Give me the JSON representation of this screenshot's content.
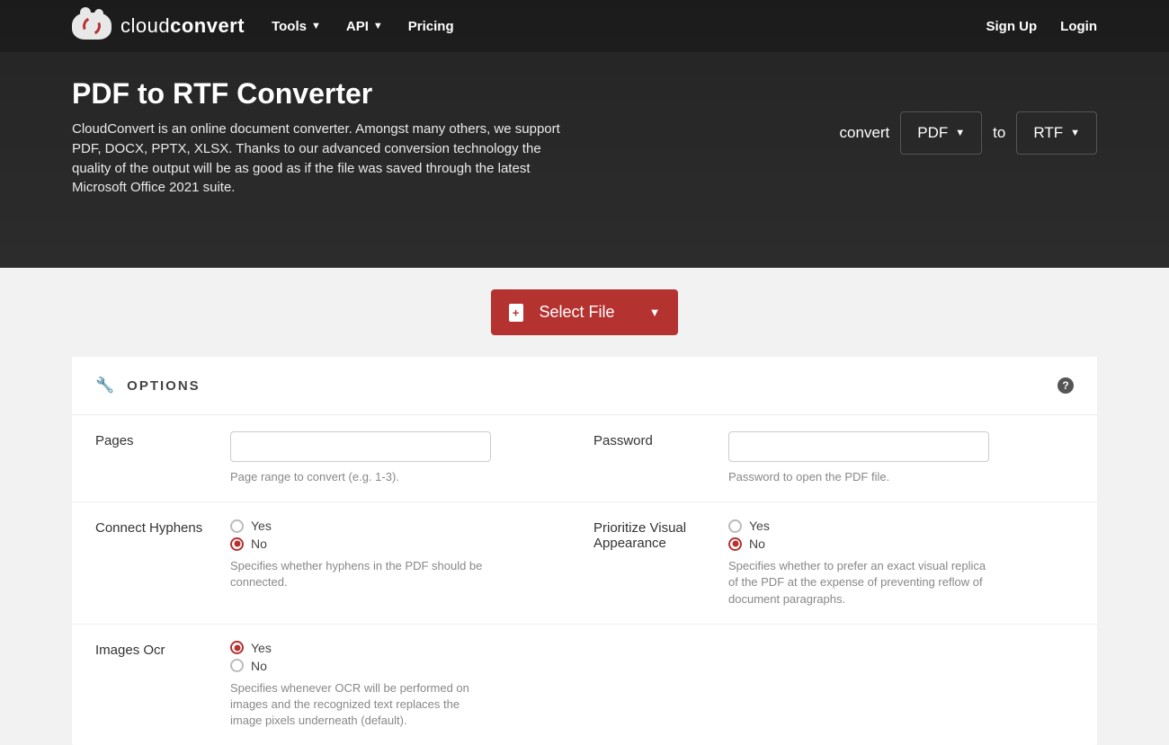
{
  "brand": {
    "light": "cloud",
    "bold": "convert"
  },
  "nav": {
    "items": [
      {
        "label": "Tools",
        "dropdown": true
      },
      {
        "label": "API",
        "dropdown": true
      },
      {
        "label": "Pricing",
        "dropdown": false
      }
    ],
    "right": [
      {
        "label": "Sign Up"
      },
      {
        "label": "Login"
      }
    ]
  },
  "hero": {
    "title": "PDF to RTF Converter",
    "description": "CloudConvert is an online document converter. Amongst many others, we support PDF, DOCX, PPTX, XLSX. Thanks to our advanced conversion technology the quality of the output will be as good as if the file was saved through the latest Microsoft Office 2021 suite.",
    "convert_label": "convert",
    "to_label": "to",
    "from_format": "PDF",
    "to_format": "RTF"
  },
  "select_file": "Select File",
  "options": {
    "title": "OPTIONS",
    "pages": {
      "label": "Pages",
      "help": "Page range to convert (e.g. 1-3)."
    },
    "password": {
      "label": "Password",
      "help": "Password to open the PDF file."
    },
    "connect_hyphens": {
      "label": "Connect Hyphens",
      "yes": "Yes",
      "no": "No",
      "selected": "no",
      "help": "Specifies whether hyphens in the PDF should be connected."
    },
    "prioritize_visual": {
      "label": "Prioritize Visual Appearance",
      "yes": "Yes",
      "no": "No",
      "selected": "no",
      "help": "Specifies whether to prefer an exact visual replica of the PDF at the expense of preventing reflow of document paragraphs."
    },
    "images_ocr": {
      "label": "Images Ocr",
      "yes": "Yes",
      "no": "No",
      "selected": "yes",
      "help": "Specifies whenever OCR will be performed on images and the recognized text replaces the image pixels underneath (default)."
    }
  }
}
